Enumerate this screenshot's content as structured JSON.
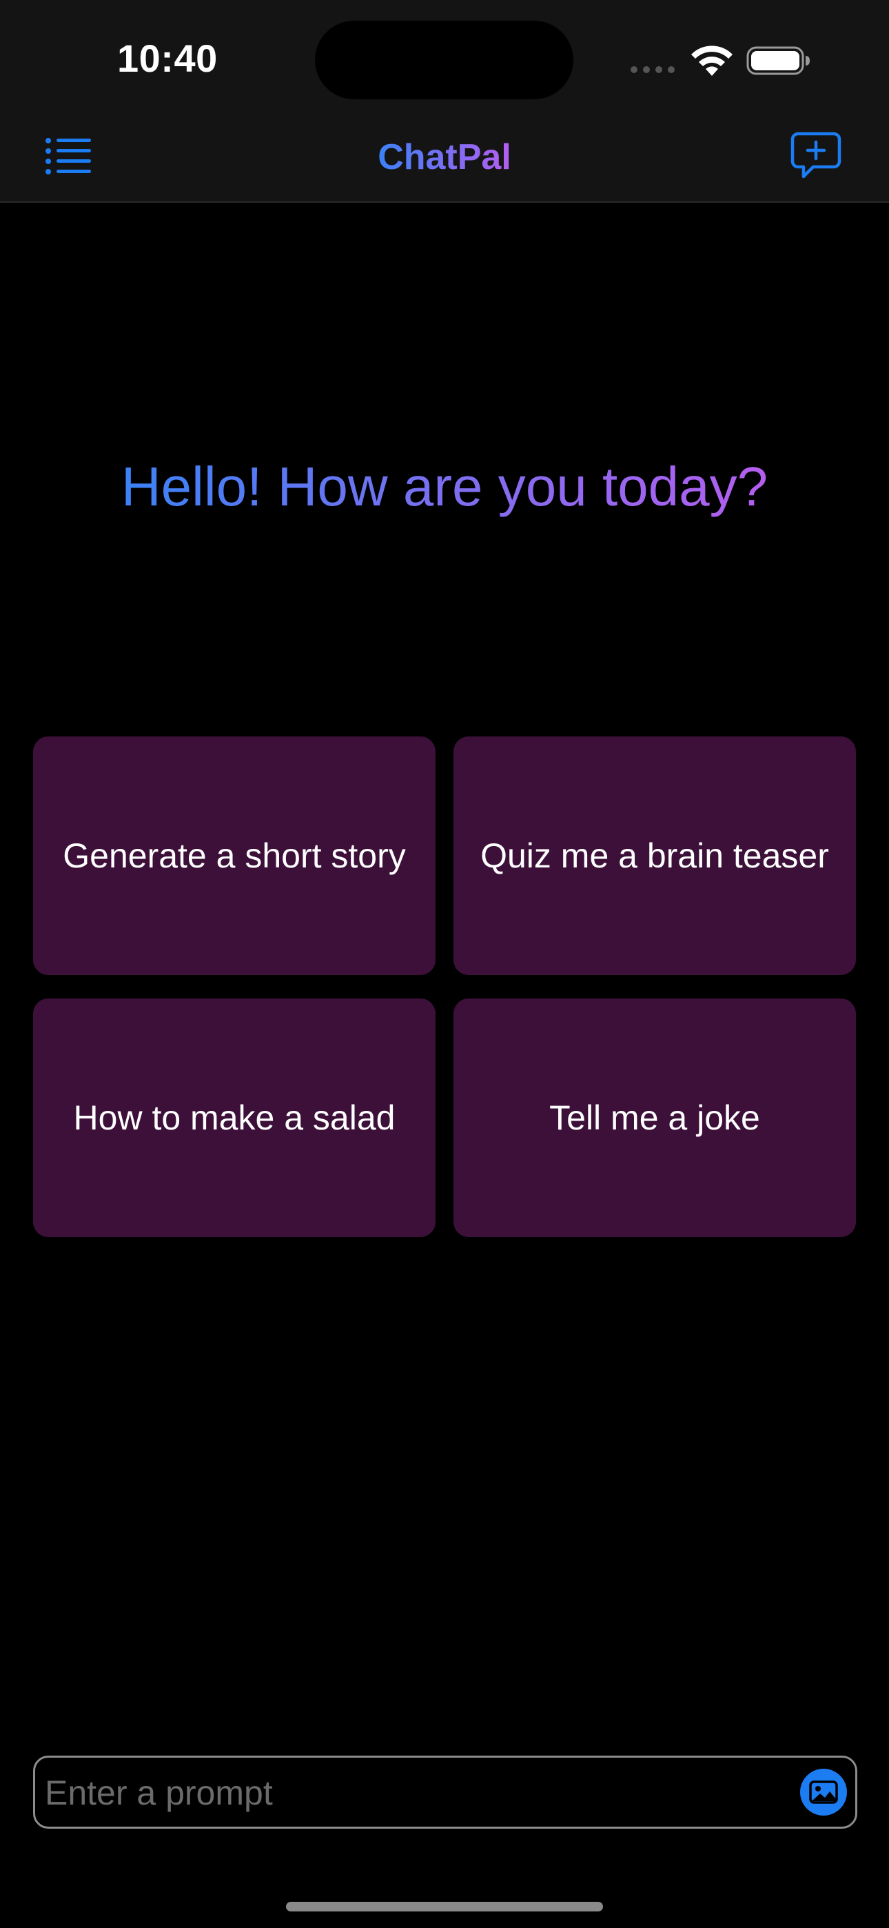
{
  "status_bar": {
    "time": "10:40"
  },
  "nav": {
    "title": "ChatPal",
    "menu_icon": "list-icon",
    "new_chat_icon": "message-plus-icon"
  },
  "main": {
    "greeting": "Hello! How are you today?",
    "suggestions": [
      {
        "label": "Generate a short story"
      },
      {
        "label": "Quiz me a brain teaser"
      },
      {
        "label": "How to make a salad"
      },
      {
        "label": "Tell me a joke"
      }
    ]
  },
  "composer": {
    "placeholder": "Enter a prompt",
    "value": "",
    "image_icon": "photo-icon"
  },
  "colors": {
    "accent": "#1c7cf2",
    "gradient_start": "#3b82f6",
    "gradient_end": "#b45ef0",
    "card_background": "#3c1039",
    "background": "#000000",
    "header_background": "#141414"
  }
}
